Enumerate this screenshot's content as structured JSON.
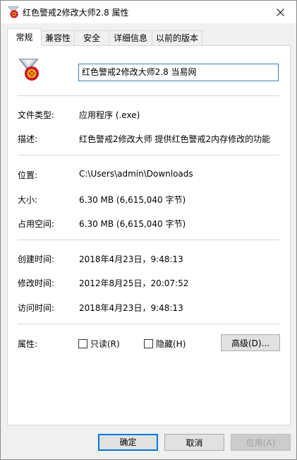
{
  "window": {
    "title": "红色警戒2修改大师2.8 属性"
  },
  "tabs": [
    {
      "label": "常规",
      "active": true
    },
    {
      "label": "兼容性",
      "active": false
    },
    {
      "label": "安全",
      "active": false
    },
    {
      "label": "详细信息",
      "active": false
    },
    {
      "label": "以前的版本",
      "active": false
    }
  ],
  "general": {
    "file_name": "红色警戒2修改大师2.8  当易网",
    "file_type_label": "文件类型:",
    "file_type_value": "应用程序 (.exe)",
    "description_label": "描述:",
    "description_value": "红色警戒2修改大师 提供红色警戒2内存修改的功能",
    "location_label": "位置:",
    "location_value": "C:\\Users\\admin\\Downloads",
    "size_label": "大小:",
    "size_value": "6.30 MB (6,615,040 字节)",
    "size_on_disk_label": "占用空间:",
    "size_on_disk_value": "6.30 MB (6,615,040 字节)",
    "created_label": "创建时间:",
    "created_value": "2018年4月23日，9:48:13",
    "modified_label": "修改时间:",
    "modified_value": "2012年8月25日，20:07:52",
    "accessed_label": "访问时间:",
    "accessed_value": "2018年4月23日，9:48:13",
    "attributes_label": "属性:",
    "readonly_label": "只读(R)",
    "readonly_checked": false,
    "hidden_label": "隐藏(H)",
    "hidden_checked": false,
    "advanced_button": "高级(D)..."
  },
  "footer": {
    "ok": "确定",
    "cancel": "取消",
    "apply": "应用(A)"
  },
  "colors": {
    "focus_border": "#0078d7",
    "field_border": "#3c7fb1",
    "icon_red": "#c8102e",
    "icon_gold": "#e8b400"
  },
  "icons": {
    "title_icon": "red-alert-app-icon",
    "close_icon": "close-icon",
    "file_icon": "red-alert-app-icon"
  }
}
